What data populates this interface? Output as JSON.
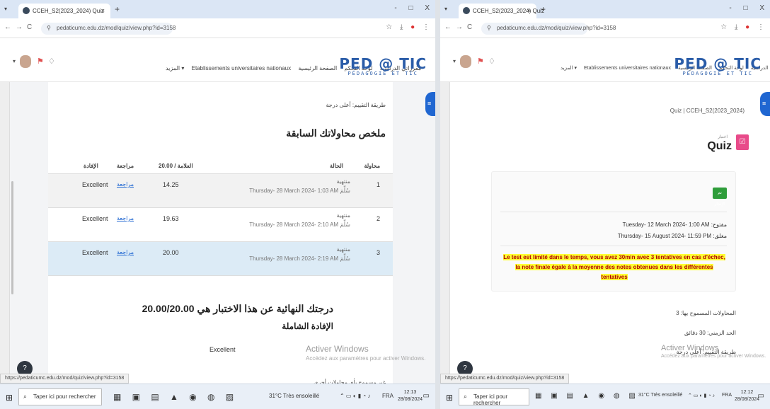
{
  "browser": {
    "tab_title": "CCEH_S2(2023_2024) Quiz",
    "tab_close": "×",
    "new_tab": "+",
    "url": "pedaticumc.edu.dz/mod/quiz/view.php?id=3158",
    "window_controls": [
      "-",
      "□",
      "X"
    ]
  },
  "moodle": {
    "logo_main": "PED @ TIC",
    "logo_sub": "PÉDAGOGIE ET TIC",
    "nav": [
      "المزيد ▾",
      "Etablissements universitaires nationaux",
      "مقرراتي الدراسية",
      "لوحة التحكم",
      "الصفحة الرئيسية"
    ]
  },
  "left": {
    "grading_method": "طريقة التقييم: أعلى درجة",
    "summary_title": "ملخص محاولاتك السابقة",
    "headers": {
      "attempt": "محاولة",
      "state": "الحالة",
      "grade": "العلامة / 20.00",
      "review": "مراجعة",
      "feedback": "الإفادة"
    },
    "attempts": [
      {
        "num": "1",
        "state": "منتهية",
        "submitted": "Thursday- 28 March 2024- 1:03 AM سُلِّمَ",
        "grade": "14.25",
        "review": "مراجعة",
        "feedback": "Excellent"
      },
      {
        "num": "2",
        "state": "منتهية",
        "submitted": "Thursday- 28 March 2024- 2:10 AM سُلِّمَ",
        "grade": "19.63",
        "review": "مراجعة",
        "feedback": "Excellent"
      },
      {
        "num": "3",
        "state": "منتهية",
        "submitted": "Thursday- 28 March 2024- 2:19 AM سُلِّمَ",
        "grade": "20.00",
        "review": "مراجعة",
        "feedback": "Excellent"
      }
    ],
    "final_grade": "درجتك النهائية عن هذا الاختبار هي 20.00/20.00",
    "overall_feedback_label": "الإفادة الشاملة",
    "overall_feedback": "Excellent",
    "more_attempts": "غير مسموح بأي محاولات أخرى",
    "status_url": "https://pedaticumc.edu.dz/mod/quiz/view.php?id=3158"
  },
  "right": {
    "breadcrumb": "Quiz  |  CCEH_S2(2023_2024)",
    "sub_label": "اختبار",
    "title": "Quiz",
    "badge": "تم الإنجاز",
    "opened": "مفتوح: Tuesday- 12 March 2024- 1:00 AM",
    "closes": "مغلق: Thursday- 15 August 2024- 11:59 PM",
    "notice": "Le test est limité dans le temps, vous avez 30min avec 3 tentatives en cas d'échec, la note finale égale à la moyenne des notes obtenues dans les différentes tentatives",
    "attempts_allowed": "المحاولات المسموح بها: 3",
    "time_limit": "الحد الزمني: 30 دقائق",
    "grading_method": "طريقة التقييم: أعلى درجة",
    "status_url": "https://pedaticumc.edu.dz/mod/quiz/view.php?id=3158"
  },
  "watermark": {
    "title": "Activer Windows",
    "sub": "Accédez aux paramètres pour activer Windows."
  },
  "taskbar": {
    "search_placeholder": "Taper ici pour rechercher",
    "weather": "31°C  Très ensoleillé",
    "lang": "FRA",
    "time": "12:13",
    "date": "28/08/2024",
    "time_right": "12:12",
    "date_right": "28/08/2024"
  }
}
